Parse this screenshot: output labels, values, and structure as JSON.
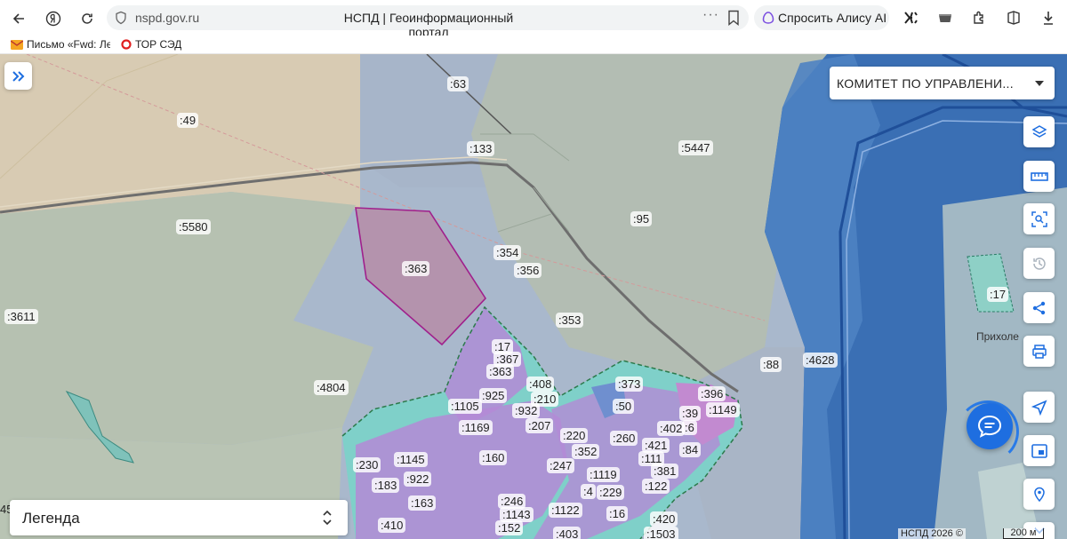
{
  "browser": {
    "url": "nspd.gov.ru",
    "tab_title": "НСПД | Геоинформационный портал",
    "more": "···",
    "alice_label": "Спросить Алису AI",
    "bookmarks": [
      {
        "label": "Письмо «Fwd: Ле",
        "icon": "mail-icon"
      },
      {
        "label": "ТОР СЭД",
        "icon": "ring-icon"
      }
    ]
  },
  "map": {
    "org_select": "КОМИТЕТ ПО УПРАВЛЕНИ...",
    "legend_label": "Легенда",
    "copyright": "НСПД 2026 ©",
    "scale": "200 м",
    "town_label": "Прихоле",
    "edge_number": "45",
    "parcel_labels": [
      ":63",
      ":49",
      ":133",
      ":5447",
      ":95",
      ":5580",
      ":354",
      ":356",
      ":363",
      ":3611",
      ":353",
      ":17",
      ":367",
      ":363",
      ":88",
      ":4628",
      ":4804",
      ":408",
      ":373",
      ":925",
      ":210",
      ":396",
      ":1105",
      ":932",
      ":50",
      ":39",
      ":1149",
      ":1169",
      ":207",
      ":6",
      ":402",
      ":220",
      ":260",
      ":421",
      ":352",
      ":111",
      ":84",
      ":160",
      ":1145",
      ":230",
      ":247",
      ":381",
      ":922",
      ":1119",
      ":183",
      ":4",
      ":229",
      ":122",
      ":163",
      ":246",
      ":1122",
      ":1143",
      ":16",
      ":420",
      ":410",
      ":152",
      ":403",
      ":1503",
      ":17"
    ]
  },
  "colors": {
    "accent": "#1e6ee0",
    "selected_parcel": "#a0208c",
    "cadastral_zone": "#b48ad6"
  }
}
